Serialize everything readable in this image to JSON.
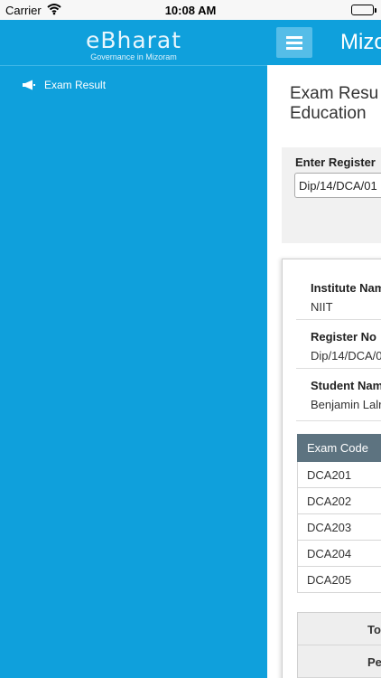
{
  "status_bar": {
    "carrier": "Carrier",
    "time": "10:08 AM"
  },
  "sidebar": {
    "logo_title": "eBharat",
    "logo_subtitle": "Governance in Mizoram",
    "items": [
      {
        "label": "Exam Result",
        "icon": "megaphone-icon"
      }
    ]
  },
  "topbar": {
    "title": "Mizo",
    "menu_icon": "hamburger-icon"
  },
  "page": {
    "title_line1": "Exam Resu",
    "title_line2": "Education"
  },
  "form": {
    "label": "Enter Register",
    "input_value": "Dip/14/DCA/01"
  },
  "result": {
    "institute_label": "Institute Nam",
    "institute_value": "NIIT",
    "register_label": "Register No",
    "register_value": "Dip/14/DCA/0",
    "student_label": "Student Nam",
    "student_value": "Benjamin Lalr",
    "table": {
      "header": "Exam Code",
      "rows": [
        "DCA201",
        "DCA202",
        "DCA203",
        "DCA204",
        "DCA205"
      ]
    },
    "summary": {
      "total_label": "Tot",
      "percent_label": "Pe"
    }
  },
  "colors": {
    "accent": "#0fa0dc",
    "table_header": "#5d7380"
  }
}
